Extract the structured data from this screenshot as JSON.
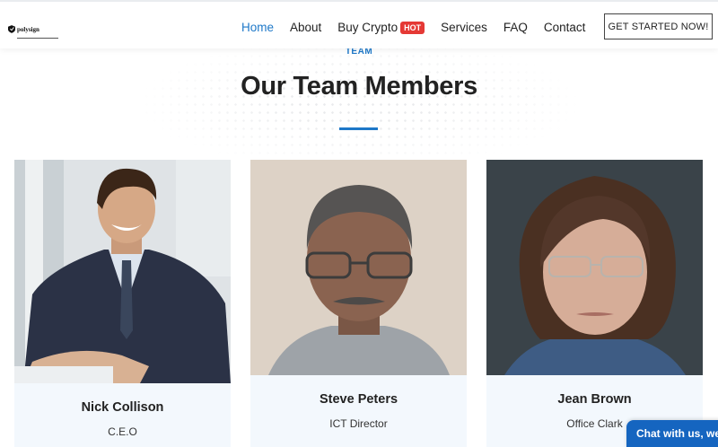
{
  "header": {
    "logo_text": "polysign",
    "nav": [
      {
        "label": "Home",
        "active": true
      },
      {
        "label": "About",
        "active": false
      },
      {
        "label": "Buy Crypto",
        "badge": "HOT",
        "active": false
      },
      {
        "label": "Services",
        "active": false
      },
      {
        "label": "FAQ",
        "active": false
      },
      {
        "label": "Contact",
        "active": false
      }
    ],
    "cta_label": "GET STARTED NOW!"
  },
  "section": {
    "kicker": "TEAM",
    "title": "Our Team Members"
  },
  "team": [
    {
      "name": "Nick Collison",
      "role": "C.E.O"
    },
    {
      "name": "Steve Peters",
      "role": "ICT Director"
    },
    {
      "name": "Jean Brown",
      "role": "Office Clark"
    }
  ],
  "chat": {
    "label": "Chat with us, we're"
  },
  "colors": {
    "accent": "#1e78c8",
    "hot_badge": "#e53935",
    "chat": "#1565c0",
    "card_bg": "#f3f8fd"
  }
}
